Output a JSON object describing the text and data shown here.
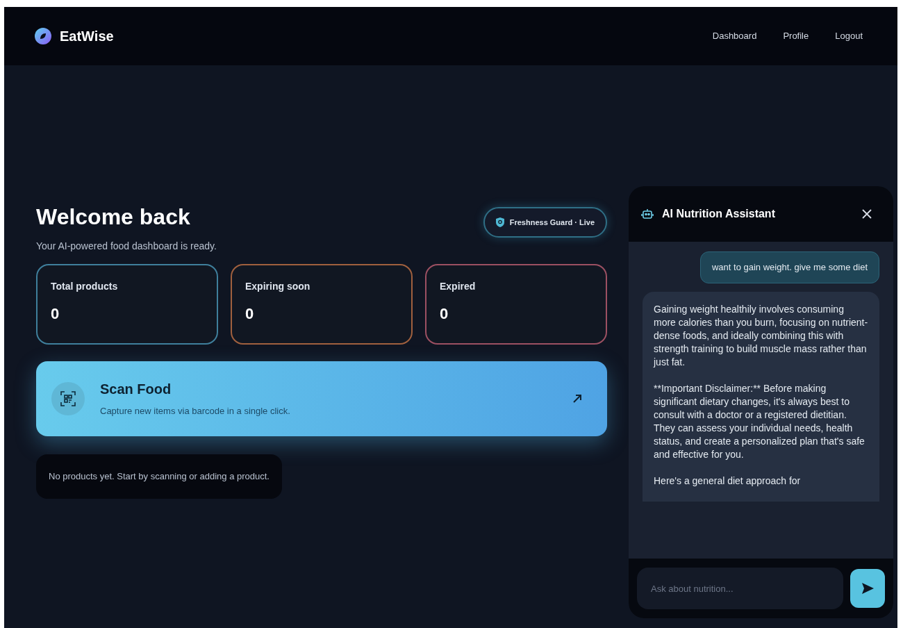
{
  "app": {
    "name": "EatWise"
  },
  "nav": [
    {
      "label": "Dashboard"
    },
    {
      "label": "Profile"
    },
    {
      "label": "Logout"
    }
  ],
  "welcome": {
    "title": "Welcome back",
    "subtitle": "Your AI-powered food dashboard is ready."
  },
  "status_badge": {
    "label": "Freshness Guard · Live"
  },
  "stats": [
    {
      "label": "Total products",
      "value": "0",
      "color": "#3f7f9c"
    },
    {
      "label": "Expiring soon",
      "value": "0",
      "color": "#a0603e"
    },
    {
      "label": "Expired",
      "value": "0",
      "color": "#9c5062"
    }
  ],
  "scan_card": {
    "title": "Scan Food",
    "description": "Capture new items via barcode in a single click."
  },
  "empty_state": "No products yet. Start by scanning or adding a product.",
  "chat": {
    "title": "AI Nutrition Assistant",
    "messages": [
      {
        "kind": "user",
        "paragraphs": [
          "want to gain weight. give me some diet"
        ]
      },
      {
        "kind": "assistant",
        "paragraphs": [
          "Gaining weight healthily involves consuming more calories than you burn, focusing on nutrient-dense foods, and ideally combining this with strength training to build muscle mass rather than just fat.",
          "**Important Disclaimer:** Before making significant dietary changes, it's always best to consult with a doctor or a registered dietitian. They can assess your individual needs, health status, and create a personalized plan that's safe and effective for you.",
          "Here's a general diet approach for"
        ]
      }
    ],
    "input": {
      "placeholder": "Ask about nutrition..."
    }
  }
}
